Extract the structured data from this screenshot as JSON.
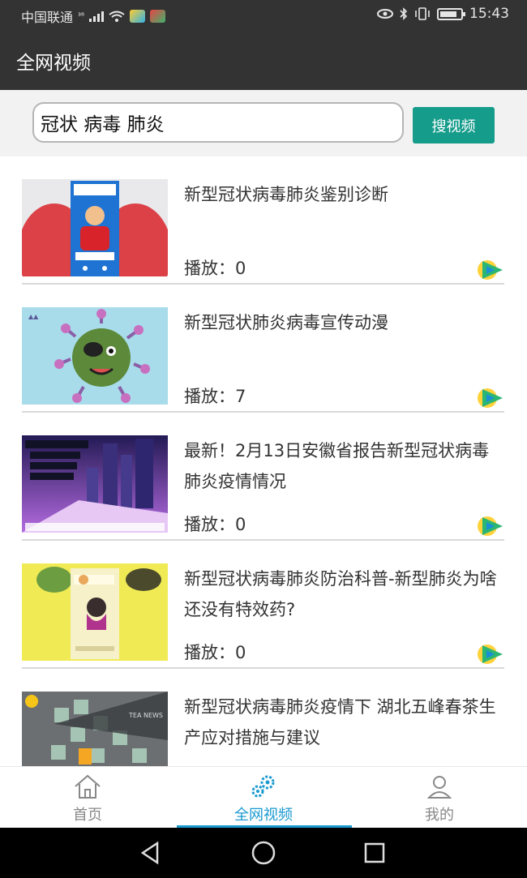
{
  "status_bar": {
    "carrier": "中国联通",
    "network": "³⁶",
    "time": "15:43",
    "battery_level": 0.85,
    "icons": [
      "signal-icon",
      "wifi-icon",
      "app-badge-icon",
      "app-badge-icon",
      "eye-icon",
      "bluetooth-icon",
      "vibrate-icon",
      "battery-icon"
    ]
  },
  "header": {
    "title": "全网视频"
  },
  "search": {
    "value": "冠状 病毒 肺炎",
    "button_label": "搜视频"
  },
  "videos": [
    {
      "title": "新型冠状病毒肺炎鉴别诊断",
      "plays_label": "播放：",
      "plays": "0"
    },
    {
      "title": "新型冠状肺炎病毒宣传动漫",
      "plays_label": "播放：",
      "plays": "7"
    },
    {
      "title": "最新！2月13日安徽省报告新型冠状病毒肺炎疫情情况",
      "plays_label": "播放：",
      "plays": "0"
    },
    {
      "title": "新型冠状病毒肺炎防治科普-新型肺炎为啥还没有特效药?",
      "plays_label": "播放：",
      "plays": "0"
    },
    {
      "title": "新型冠状病毒肺炎疫情下 湖北五峰春茶生产应对措施与建议",
      "plays_label": "",
      "plays": ""
    }
  ],
  "nav": {
    "items": [
      {
        "label": "首页",
        "icon": "home-icon"
      },
      {
        "label": "全网视频",
        "icon": "gears-icon"
      },
      {
        "label": "我的",
        "icon": "user-icon"
      }
    ],
    "active_index": 1
  },
  "colors": {
    "accent": "#169c8b",
    "nav_active": "#1b9ad0",
    "header_bg": "#333333"
  }
}
